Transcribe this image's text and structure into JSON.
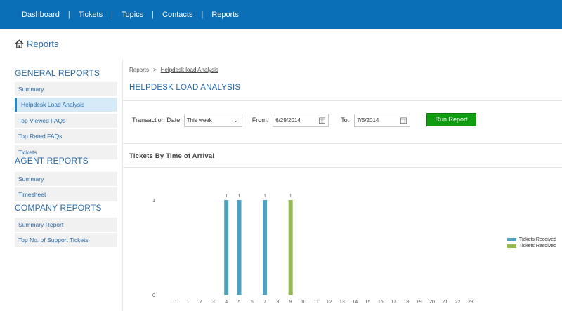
{
  "nav": {
    "items": [
      "Dashboard",
      "Tickets",
      "Topics",
      "Contacts",
      "Reports"
    ],
    "separator": "|"
  },
  "page": {
    "title": "Reports"
  },
  "sidebar": {
    "general_head": "GENERAL REPORTS",
    "general_items": [
      "Summary",
      "Helpdesk Load Analysis",
      "Top Viewed FAQs",
      "Top Rated FAQs",
      "Tickets"
    ],
    "agent_head": "AGENT REPORTS",
    "agent_items": [
      "Summary",
      "Timesheet"
    ],
    "company_head": "COMPANY REPORTS",
    "company_items": [
      "Summary Report",
      "Top No. of Support Tickets"
    ],
    "active": "Helpdesk Load Analysis"
  },
  "breadcrumb": {
    "root": "Reports",
    "sep": ">",
    "current": "Helpdesk load Analysis"
  },
  "main": {
    "title": "HELPDESK LOAD ANALYSIS"
  },
  "filters": {
    "transaction_label": "Transaction Date:",
    "transaction_value": "This week",
    "from_label": "From:",
    "from_value": "6/29/2014",
    "to_label": "To:",
    "to_value": "7/5/2014",
    "run_label": "Run Report"
  },
  "colors": {
    "nav_bg": "#0b6fb8",
    "accent": "#2a6aa8",
    "run_btn": "#109d10",
    "received": "#4ca3c0",
    "resolved": "#95b957"
  },
  "chart_data": {
    "type": "bar",
    "title": "Tickets By Time of Arrival",
    "categories": [
      "0",
      "1",
      "2",
      "3",
      "4",
      "5",
      "6",
      "7",
      "8",
      "9",
      "10",
      "11",
      "12",
      "13",
      "14",
      "15",
      "16",
      "17",
      "18",
      "19",
      "20",
      "21",
      "22",
      "23"
    ],
    "series": [
      {
        "name": "Tickets Received",
        "color": "#4ca3c0",
        "values": [
          0,
          0,
          0,
          0,
          1,
          1,
          0,
          1,
          0,
          0,
          0,
          0,
          0,
          0,
          0,
          0,
          0,
          0,
          0,
          0,
          0,
          0,
          0,
          0
        ]
      },
      {
        "name": "Tickets Resolved",
        "color": "#95b957",
        "values": [
          0,
          0,
          0,
          0,
          0,
          0,
          0,
          0,
          0,
          1,
          0,
          0,
          0,
          0,
          0,
          0,
          0,
          0,
          0,
          0,
          0,
          0,
          0,
          0
        ]
      }
    ],
    "y_ticks": [
      "0",
      "1"
    ],
    "ylim": [
      0,
      1
    ],
    "legend": "right",
    "grid": false,
    "data_labels": true
  }
}
